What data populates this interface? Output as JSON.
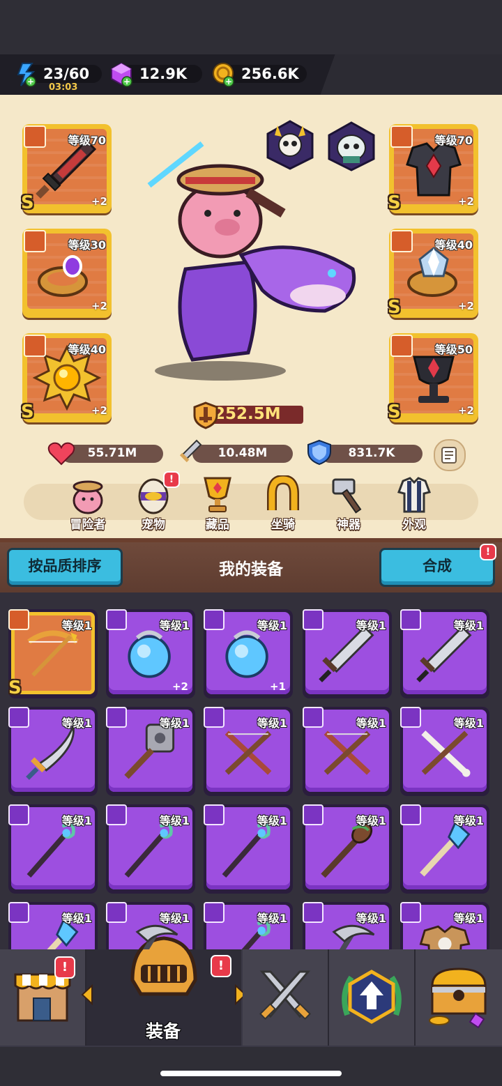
{
  "resources": {
    "energy": {
      "value": "23/60",
      "timer": "03:03",
      "icon": "lightning-icon",
      "color": "#3aa6ff"
    },
    "gems": {
      "value": "12.9K",
      "icon": "gem-icon",
      "color": "#c04cf0"
    },
    "gold": {
      "value": "256.6K",
      "icon": "coin-icon",
      "color": "#f2b21e"
    }
  },
  "equipped": {
    "left": [
      {
        "level": "等级70",
        "grade": "S",
        "plus": "+2",
        "icon": "sword-icon"
      },
      {
        "level": "等级30",
        "grade": "",
        "plus": "+2",
        "icon": "ring-icon"
      },
      {
        "level": "等级40",
        "grade": "S",
        "plus": "+2",
        "icon": "sun-amulet-icon"
      }
    ],
    "right": [
      {
        "level": "等级70",
        "grade": "S",
        "plus": "+2",
        "icon": "armor-icon"
      },
      {
        "level": "等级40",
        "grade": "S",
        "plus": "+2",
        "icon": "crystal-ring-icon"
      },
      {
        "level": "等级50",
        "grade": "S",
        "plus": "+2",
        "icon": "chalice-icon"
      }
    ]
  },
  "pets": [
    {
      "icon": "skull-pet-icon"
    },
    {
      "icon": "ghost-pet-icon"
    }
  ],
  "power": "252.5M",
  "stats": {
    "hp": {
      "value": "55.71M",
      "icon": "heart-icon"
    },
    "attack": {
      "value": "10.48M",
      "icon": "sword-stat-icon"
    },
    "defense": {
      "value": "831.7K",
      "icon": "shield-icon"
    }
  },
  "hero_tabs": [
    {
      "label": "冒险者",
      "icon": "adventurer-icon"
    },
    {
      "label": "宠物",
      "icon": "pet-egg-icon",
      "badge": "!"
    },
    {
      "label": "藏品",
      "icon": "trophy-icon"
    },
    {
      "label": "坐骑",
      "icon": "horseshoe-icon"
    },
    {
      "label": "神器",
      "icon": "hammer-icon"
    },
    {
      "label": "外观",
      "icon": "outfit-icon"
    }
  ],
  "inventory": {
    "sort_label": "按品质排序",
    "title": "我的装备",
    "merge_label": "合成",
    "merge_badge": "!",
    "items": [
      {
        "level": "等级1",
        "grade": "S",
        "plus": "",
        "rarity": "gold",
        "icon": "crossbow-icon"
      },
      {
        "level": "等级1",
        "grade": "",
        "plus": "+2",
        "rarity": "purple",
        "icon": "blue-orb-icon"
      },
      {
        "level": "等级1",
        "grade": "",
        "plus": "+1",
        "rarity": "purple",
        "icon": "blue-orb-icon"
      },
      {
        "level": "等级1",
        "grade": "",
        "plus": "",
        "rarity": "purple",
        "icon": "greatsword-icon"
      },
      {
        "level": "等级1",
        "grade": "",
        "plus": "",
        "rarity": "purple",
        "icon": "greatsword-icon"
      },
      {
        "level": "等级1",
        "grade": "",
        "plus": "",
        "rarity": "purple",
        "icon": "scimitar-icon"
      },
      {
        "level": "等级1",
        "grade": "",
        "plus": "",
        "rarity": "purple",
        "icon": "warhammer-icon"
      },
      {
        "level": "等级1",
        "grade": "",
        "plus": "",
        "rarity": "purple",
        "icon": "bow-icon"
      },
      {
        "level": "等级1",
        "grade": "",
        "plus": "",
        "rarity": "purple",
        "icon": "bow-icon"
      },
      {
        "level": "等级1",
        "grade": "",
        "plus": "",
        "rarity": "purple",
        "icon": "bone-bow-icon"
      },
      {
        "level": "等级1",
        "grade": "",
        "plus": "",
        "rarity": "purple",
        "icon": "staff-icon"
      },
      {
        "level": "等级1",
        "grade": "",
        "plus": "",
        "rarity": "purple",
        "icon": "staff-icon"
      },
      {
        "level": "等级1",
        "grade": "",
        "plus": "",
        "rarity": "purple",
        "icon": "staff-icon"
      },
      {
        "level": "等级1",
        "grade": "",
        "plus": "",
        "rarity": "purple",
        "icon": "wood-club-icon"
      },
      {
        "level": "等级1",
        "grade": "",
        "plus": "",
        "rarity": "purple",
        "icon": "crystal-staff-icon"
      },
      {
        "level": "等级1",
        "grade": "",
        "plus": "",
        "rarity": "purple",
        "icon": "crystal-staff-icon"
      },
      {
        "level": "等级1",
        "grade": "",
        "plus": "",
        "rarity": "purple",
        "icon": "scythe-icon"
      },
      {
        "level": "等级1",
        "grade": "",
        "plus": "",
        "rarity": "purple",
        "icon": "staff-icon"
      },
      {
        "level": "等级1",
        "grade": "",
        "plus": "",
        "rarity": "purple",
        "icon": "scythe-icon"
      },
      {
        "level": "等级1",
        "grade": "",
        "plus": "",
        "rarity": "purple",
        "icon": "armor-icon"
      }
    ]
  },
  "bottom_nav": {
    "active_label": "装备",
    "shop_badge": "!",
    "equip_badge": "!",
    "items": [
      {
        "icon": "shop-icon"
      },
      {
        "icon": "helmet-icon"
      },
      {
        "icon": "crossed-swords-icon"
      },
      {
        "icon": "upgrade-arrow-icon"
      },
      {
        "icon": "treasure-chest-icon"
      }
    ]
  }
}
